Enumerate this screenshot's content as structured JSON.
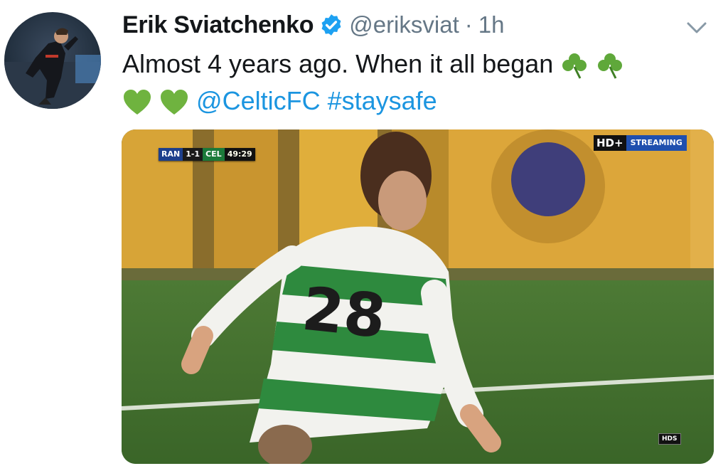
{
  "tweet": {
    "display_name": "Erik Sviatchenko",
    "handle": "@eriksviat",
    "separator": "·",
    "time": "1h",
    "text_line1": "Almost 4 years ago. When it all began",
    "mention": "@CelticFC",
    "hashtag": "#staysafe",
    "emojis": [
      "shamrock",
      "shamrock",
      "green-heart",
      "green-heart"
    ]
  },
  "media": {
    "scorebug": {
      "home": "RAN",
      "score": "1-1",
      "away": "CEL",
      "clock": "49:29"
    },
    "hd_label": "HD+",
    "streaming_label": "STREAMING",
    "corner_logo": "HDS",
    "shirt_number": "28"
  },
  "colors": {
    "text": "#14171a",
    "secondary": "#657786",
    "link": "#1b95e0",
    "verified": "#1da1f2"
  }
}
